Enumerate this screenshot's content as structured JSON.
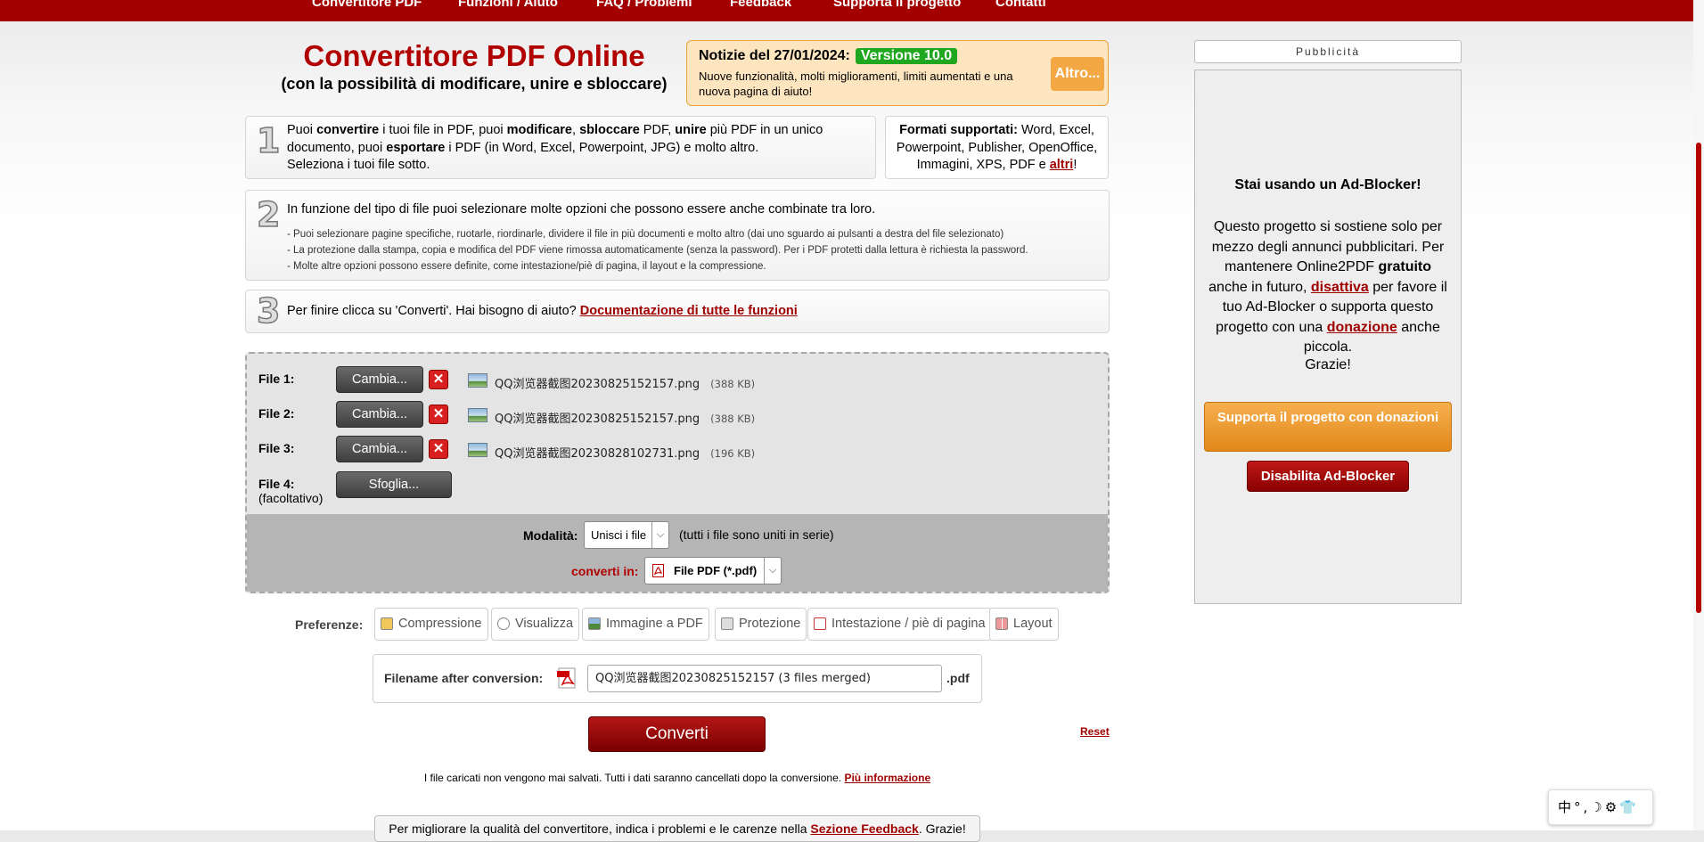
{
  "nav": {
    "items": [
      "Convertitore PDF",
      "Funzioni / Aiuto",
      "FAQ / Problemi",
      "Feedback",
      "Supporta il progetto",
      "Contatti"
    ]
  },
  "header": {
    "title": "Convertitore PDF Online",
    "subtitle": "(con la possibilità di modificare, unire e sbloccare)"
  },
  "news": {
    "heading": "Notizie del 27/01/2024:",
    "badge": "Versione 10.0",
    "text": "Nuove funzionalità, molti miglioramenti, limiti aumentati e una nuova pagina di aiuto!",
    "more_button": "Altro..."
  },
  "steps": {
    "step1": {
      "number": "1",
      "p1": "Puoi ",
      "b1": "convertire",
      "p2": " i tuoi file in PDF, puoi ",
      "b2": "modificare",
      "p3": ", ",
      "b3": "sbloccare",
      "p4": " PDF, ",
      "b4": "unire",
      "p5": " più PDF in un unico documento, puoi ",
      "b5": "esportare",
      "p6": " i PDF (in Word, Excel, Powerpoint, JPG) e molto altro.",
      "line3": "Seleziona i tuoi file sotto."
    },
    "formats": {
      "label": "Formati supportati:",
      "text": " Word, Excel, Powerpoint, Publisher, OpenOffice, Immagini, XPS, PDF e ",
      "link": "altri",
      "end": "!"
    },
    "step2": {
      "number": "2",
      "text": "In funzione del tipo di file puoi selezionare molte opzioni che possono essere anche combinate tra loro.",
      "bullets": [
        "- Puoi selezionare pagine specifiche, ruotarle, riordinarle, dividere il file in più documenti e molto altro (dai uno sguardo ai pulsanti a destra del file selezionato)",
        "- La protezione dalla stampa, copia e modifica del PDF viene rimossa automaticamente (senza la password). Per i PDF protetti dalla lettura è richiesta la password.",
        "- Molte altre opzioni possono essere definite, come intestazione/piè di pagina, il layout e la compressione."
      ]
    },
    "step3": {
      "number": "3",
      "text": "Per finire clicca su 'Converti'. Hai bisogno di aiuto? ",
      "link": "Documentazione di tutte le funzioni"
    }
  },
  "files": [
    {
      "label": "File 1:",
      "button": "Cambia...",
      "name": "QQ浏览器截图20230825152157.png",
      "size": "(388 KB)"
    },
    {
      "label": "File 2:",
      "button": "Cambia...",
      "name": "QQ浏览器截图20230825152157.png",
      "size": "(388 KB)"
    },
    {
      "label": "File 3:",
      "button": "Cambia...",
      "name": "QQ浏览器截图20230828102731.png",
      "size": "(196 KB)"
    }
  ],
  "file4": {
    "label": "File 4:",
    "optional": "(facoltativo)",
    "button": "Sfoglia..."
  },
  "remove_glyph": "✕",
  "mode": {
    "label": "Modalità:",
    "value": "Unisci i file",
    "hint": "(tutti i file sono uniti in serie)"
  },
  "convert_to": {
    "label": "converti in:",
    "value": "File PDF (*.pdf)"
  },
  "prefs": {
    "label": "Preferenze:",
    "buttons": [
      "Compressione",
      "Visualizza",
      "Immagine a PDF",
      "Protezione",
      "Intestazione / piè di pagina",
      "Layout"
    ]
  },
  "output": {
    "label": "Filename after conversion:",
    "value": "QQ浏览器截图20230825152157 (3 files merged)",
    "ext": ".pdf"
  },
  "convert_button": "Converti",
  "reset_link": "Reset",
  "notice": {
    "text": "I file caricati non vengono mai salvati. Tutti i dati saranno cancellati dopo la conversione. ",
    "link": "Più informazione"
  },
  "feedback": {
    "text": "Per migliorare la qualità del convertitore, indica i problemi e le carenze nella ",
    "link": "Sezione Feedback",
    "end": ". Grazie!"
  },
  "ad": {
    "header": "Pubblicità",
    "title": "Stai usando un Ad-Blocker!",
    "t1": "Questo progetto si sostiene solo per mezzo degli annunci pubblicitari. Per mantenere Online2PDF ",
    "b1": "gratuito",
    "t2": " anche in futuro, ",
    "l1": "disattiva",
    "t3": " per favore il tuo Ad-Blocker o supporta questo progetto con una ",
    "l2": "donazione",
    "t4": " anche piccola.",
    "thanks": "Grazie!",
    "support_button": "Supporta il progetto con donazioni",
    "disable_button": "Disabilita Ad-Blocker"
  },
  "ime": {
    "text": "中°,☽⚙👕"
  },
  "colors": {
    "brand": "#a30000",
    "accent": "#f3a844",
    "version_badge": "#1fa81f"
  }
}
